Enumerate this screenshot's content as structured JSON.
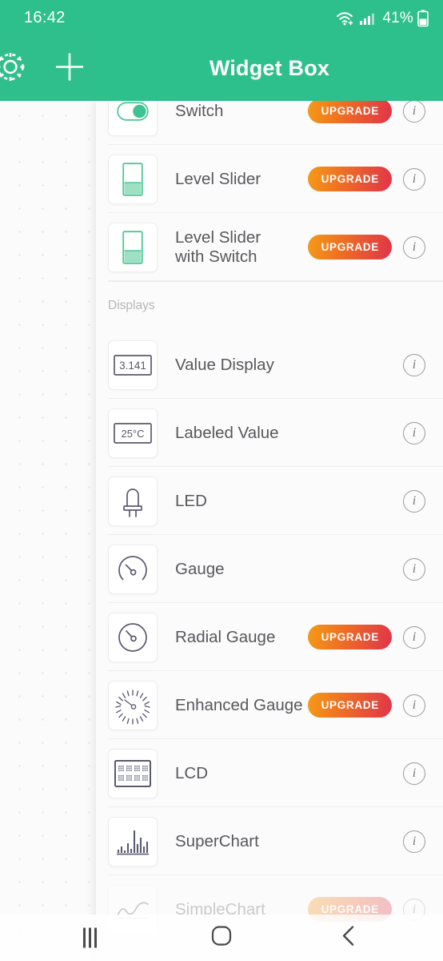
{
  "status_bar": {
    "time": "16:42",
    "battery_percent": "41%",
    "icons": [
      "wifi-icon",
      "cellular-signal-icon",
      "battery-icon"
    ]
  },
  "app_bar": {
    "title": "Widget Box",
    "settings_icon": "gear-icon",
    "add_icon": "plus-icon",
    "background_color": "#2ec08c"
  },
  "colors": {
    "accent_green": "#2ec08c",
    "icon_green": "#4ec79a",
    "badge_gradient_start": "#f59b18",
    "badge_gradient_end": "#e0334a",
    "label_text": "#58585d",
    "section_text": "#b6b6ba",
    "icon_stroke": "#5a5a6e",
    "panel_background": "#fbfbfb"
  },
  "widget_list": [
    {
      "label": "Switch",
      "icon": "toggle-switch-icon",
      "badge": "UPGRADE",
      "info": "i"
    },
    {
      "label": "Level Slider",
      "icon": "level-slider-icon",
      "badge": "UPGRADE",
      "info": "i"
    },
    {
      "label": "Level Slider\nwith Switch",
      "icon": "level-slider-icon",
      "badge": "UPGRADE",
      "info": "i"
    }
  ],
  "section": {
    "title": "Displays"
  },
  "display_list": [
    {
      "label": "Value Display",
      "icon": "value-display-icon",
      "icon_text": "3.141",
      "badge": "",
      "info": "i"
    },
    {
      "label": "Labeled Value",
      "icon": "labeled-value-icon",
      "icon_text": "25°C",
      "badge": "",
      "info": "i"
    },
    {
      "label": "LED",
      "icon": "led-icon",
      "badge": "",
      "info": "i"
    },
    {
      "label": "Gauge",
      "icon": "gauge-icon",
      "badge": "",
      "info": "i"
    },
    {
      "label": "Radial Gauge",
      "icon": "radial-gauge-icon",
      "badge": "UPGRADE",
      "info": "i"
    },
    {
      "label": "Enhanced Gauge",
      "icon": "enhanced-gauge-icon",
      "badge": "UPGRADE",
      "info": "i"
    },
    {
      "label": "LCD",
      "icon": "lcd-icon",
      "badge": "",
      "info": "i"
    },
    {
      "label": "SuperChart",
      "icon": "superchart-icon",
      "badge": "",
      "info": "i"
    },
    {
      "label": "SimpleChart",
      "icon": "simplechart-icon",
      "badge": "UPGRADE",
      "info": "i"
    }
  ],
  "nav_bar": {
    "recent_label": "recent-apps",
    "home_label": "home",
    "back_label": "back"
  }
}
